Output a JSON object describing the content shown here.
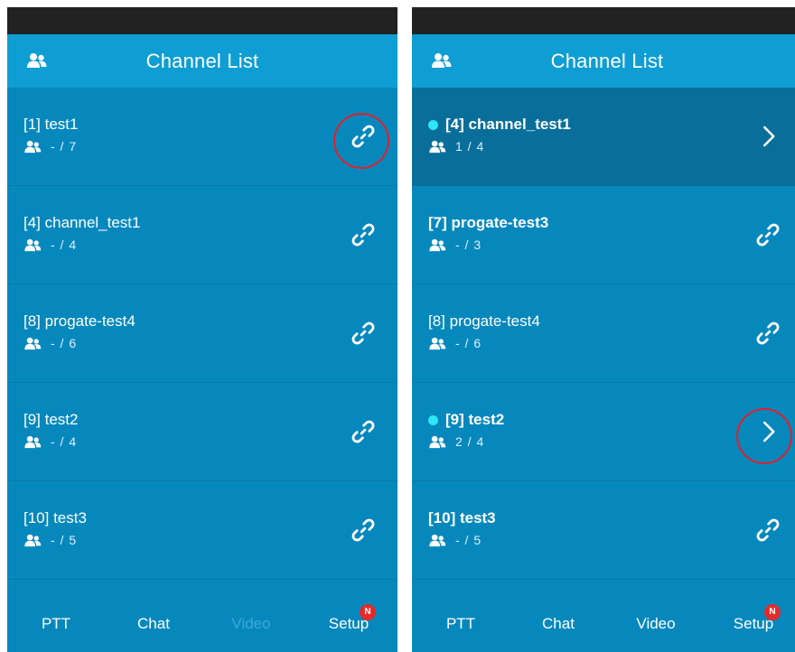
{
  "left": {
    "header": {
      "title": "Channel List"
    },
    "channels": [
      {
        "name": "[1] test1",
        "count": "- / 7",
        "active": false,
        "action": "link"
      },
      {
        "name": "[4] channel_test1",
        "count": "- / 4",
        "active": false,
        "action": "link"
      },
      {
        "name": "[8] progate-test4",
        "count": "- / 6",
        "active": false,
        "action": "link"
      },
      {
        "name": "[9] test2",
        "count": "- / 4",
        "active": false,
        "action": "link"
      },
      {
        "name": "[10] test3",
        "count": "- / 5",
        "active": false,
        "action": "link"
      }
    ],
    "tabs": [
      {
        "label": "PTT",
        "enabled": true
      },
      {
        "label": "Chat",
        "enabled": true
      },
      {
        "label": "Video",
        "enabled": false
      },
      {
        "label": "Setup",
        "enabled": true,
        "badge": "N"
      }
    ]
  },
  "right": {
    "header": {
      "title": "Channel List"
    },
    "channels": [
      {
        "name": "[4] channel_test1",
        "count": "1 / 4",
        "active": true,
        "action": "chevron"
      },
      {
        "name": "[7] progate-test3",
        "count": "- / 3",
        "active": false,
        "action": "link"
      },
      {
        "name": "[8] progate-test4",
        "count": "- / 6",
        "active": false,
        "action": "link"
      },
      {
        "name": "[9] test2",
        "count": "2 / 4",
        "active": true,
        "action": "chevron"
      },
      {
        "name": "[10] test3",
        "count": "- / 5",
        "active": false,
        "action": "link"
      }
    ],
    "tabs": [
      {
        "label": "PTT",
        "enabled": true
      },
      {
        "label": "Chat",
        "enabled": true
      },
      {
        "label": "Video",
        "enabled": true
      },
      {
        "label": "Setup",
        "enabled": true,
        "badge": "N"
      }
    ]
  },
  "colors": {
    "background": "#0788bd",
    "header": "#0e9ed3",
    "active_row": "#096f9a",
    "active_dot": "#2ee6f5",
    "highlight_ring": "#e0202a",
    "badge": "#e32b2b"
  }
}
